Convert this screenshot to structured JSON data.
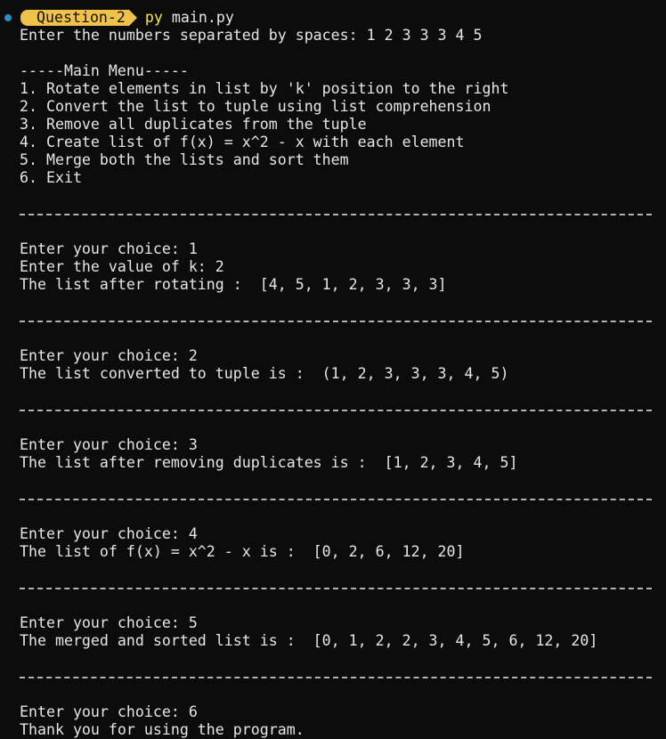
{
  "prompt": {
    "segment_label": "Question-2",
    "command": "py",
    "argument": "main.py"
  },
  "lines": {
    "enter_numbers": "Enter the numbers separated by spaces: 1 2 3 3 3 4 5",
    "menu_title": "-----Main Menu-----",
    "menu_1": "1. Rotate elements in list by 'k' position to the right",
    "menu_2": "2. Convert the list to tuple using list comprehension",
    "menu_3": "3. Remove all duplicates from the tuple",
    "menu_4": "4. Create list of f(x) = x^2 - x with each element",
    "menu_5": "5. Merge both the lists and sort them",
    "menu_6": "6. Exit",
    "choice_1": "Enter your choice: 1",
    "k_value": "Enter the value of k: 2",
    "rotate_result": "The list after rotating :  [4, 5, 1, 2, 3, 3, 3]",
    "choice_2": "Enter your choice: 2",
    "tuple_result": "The list converted to tuple is :  (1, 2, 3, 3, 3, 4, 5)",
    "choice_3": "Enter your choice: 3",
    "dedup_result": "The list after removing duplicates is :  [1, 2, 3, 4, 5]",
    "choice_4": "Enter your choice: 4",
    "fx_result": "The list of f(x) = x^2 - x is :  [0, 2, 6, 12, 20]",
    "choice_5": "Enter your choice: 5",
    "merge_result": "The merged and sorted list is :  [0, 1, 2, 2, 3, 4, 5, 6, 12, 20]",
    "choice_6": "Enter your choice: 6",
    "thanks": "Thank you for using the program."
  },
  "colors": {
    "background": "#0c0c0c",
    "text": "#e6e6e6",
    "segment": "#f0c24a",
    "command": "#f5e14a",
    "status_dot": "#2b8fc7"
  }
}
